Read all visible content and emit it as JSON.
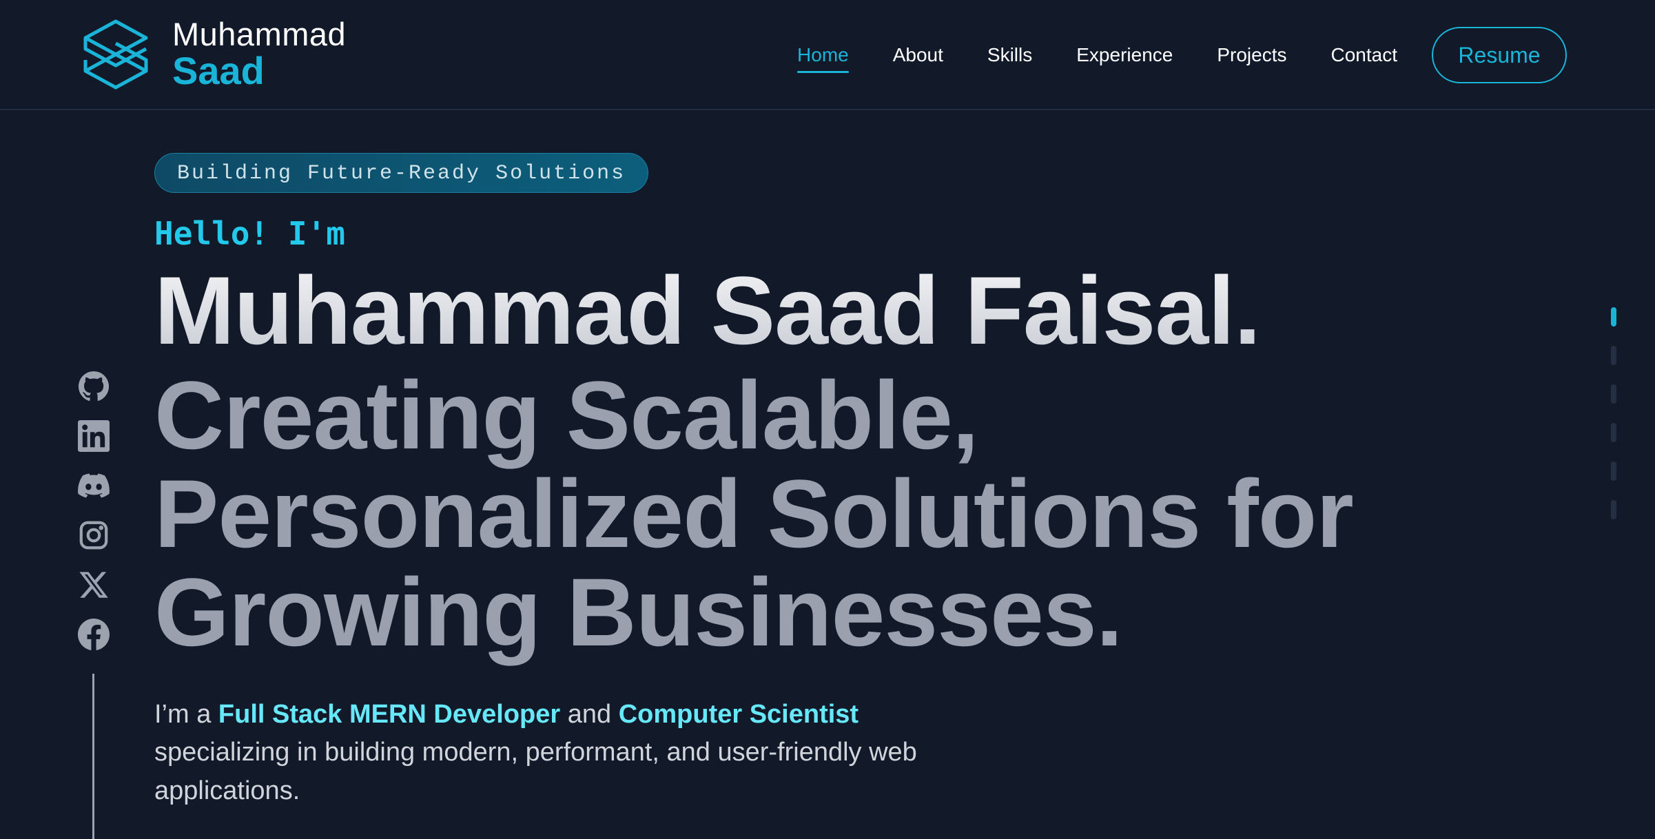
{
  "header": {
    "logo": {
      "first_name": "Muhammad",
      "last_name": "Saad",
      "icon": "cube-logo-icon"
    },
    "nav": [
      {
        "label": "Home",
        "active": true
      },
      {
        "label": "About",
        "active": false
      },
      {
        "label": "Skills",
        "active": false
      },
      {
        "label": "Experience",
        "active": false
      },
      {
        "label": "Projects",
        "active": false
      },
      {
        "label": "Contact",
        "active": false
      }
    ],
    "resume_label": "Resume"
  },
  "social": [
    "github-icon",
    "linkedin-icon",
    "discord-icon",
    "instagram-icon",
    "x-icon",
    "facebook-icon"
  ],
  "hero": {
    "badge": "Building Future-Ready Solutions",
    "greeting": "Hello! I'm",
    "name": "Muhammad Saad Faisal.",
    "tagline": {
      "line1": "Creating Scalable,",
      "line2": "Personalized Solutions for",
      "line3": "Growing Businesses."
    },
    "intro": {
      "prefix": "I’m a",
      "role1": "Full Stack MERN Developer",
      "joiner": "and",
      "role2": "Computer Scientist",
      "rest": "specializing in building modern, performant, and user-friendly web applications."
    }
  },
  "section_dots": {
    "count": 6,
    "active_index": 0
  },
  "colors": {
    "background": "#121a2a",
    "accent": "#1ab4d8",
    "highlight": "#67e8f9",
    "muted_heading": "#9aa0ad"
  }
}
